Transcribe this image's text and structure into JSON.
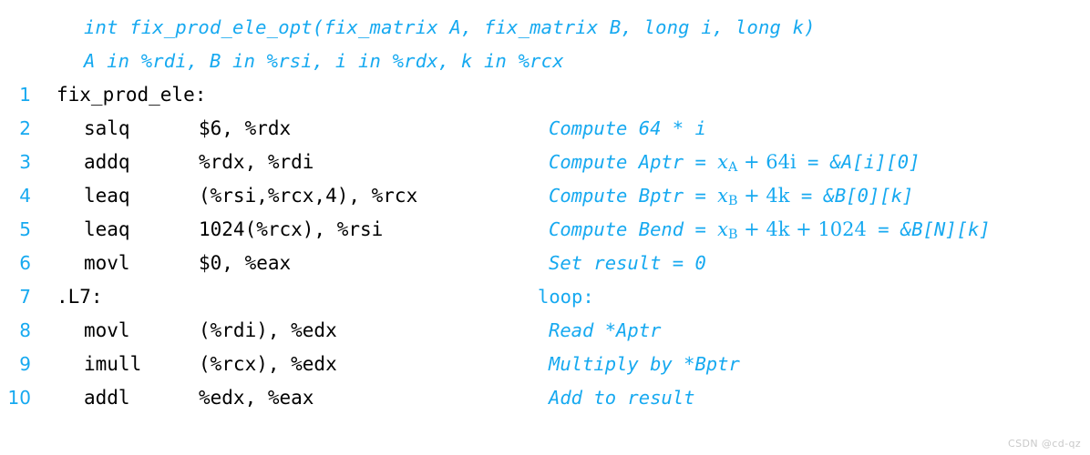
{
  "colors": {
    "accent_blue": "#16a9f0",
    "code_black": "#000000",
    "background": "#ffffff",
    "watermark_gray": "#c9c9c9"
  },
  "header": {
    "signature": "int fix_prod_ele_opt(fix_matrix A, fix_matrix B, long i, long k)",
    "registers": "A in %rdi, B in %rsi, i in %rdx, k in %rcx"
  },
  "code": [
    {
      "lineno": "1",
      "label": "fix_prod_ele:",
      "mnemonic": "",
      "operands": "",
      "comment": ""
    },
    {
      "lineno": "2",
      "label": "",
      "mnemonic": "salq",
      "operands": "$6, %rdx",
      "comment": "Compute 64 * i"
    },
    {
      "lineno": "3",
      "label": "",
      "mnemonic": "addq",
      "operands": "%rdx, %rdi",
      "comment": "Compute Aptr = xA + 64i = &A[i][0]",
      "comment_parts": {
        "pre": "Compute Aptr = ",
        "math": "xA + 64i",
        "post": " = &A[i][0]"
      }
    },
    {
      "lineno": "4",
      "label": "",
      "mnemonic": "leaq",
      "operands": "(%rsi,%rcx,4), %rcx",
      "comment": "Compute Bptr = xB + 4k = &B[0][k]",
      "comment_parts": {
        "pre": "Compute Bptr = ",
        "math": "xB + 4k",
        "post": " = &B[0][k]"
      }
    },
    {
      "lineno": "5",
      "label": "",
      "mnemonic": "leaq",
      "operands": "1024(%rcx), %rsi",
      "comment": "Compute Bend = xB + 4k + 1024 = &B[N][k]",
      "comment_parts": {
        "pre": "Compute Bend = ",
        "math": "xB + 4k + 1024",
        "post": " = &B[N][k]"
      }
    },
    {
      "lineno": "6",
      "label": "",
      "mnemonic": "movl",
      "operands": "$0, %eax",
      "comment": "Set result = 0"
    },
    {
      "lineno": "7",
      "label": ".L7:",
      "mnemonic": "",
      "operands": "",
      "comment": "loop:",
      "comment_style": "upright"
    },
    {
      "lineno": "8",
      "label": "",
      "mnemonic": "movl",
      "operands": "(%rdi), %edx",
      "comment": "Read *Aptr"
    },
    {
      "lineno": "9",
      "label": "",
      "mnemonic": "imull",
      "operands": "(%rcx), %edx",
      "comment": "Multiply by *Bptr"
    },
    {
      "lineno": "10",
      "label": "",
      "mnemonic": "addl",
      "operands": "%edx, %eax",
      "comment": "Add to result"
    }
  ],
  "math_fragments": {
    "row3": {
      "base": "x",
      "sub": "A",
      "rest": " + 64i"
    },
    "row4": {
      "base": "x",
      "sub": "B",
      "rest": " + 4k"
    },
    "row5": {
      "base": "x",
      "sub": "B",
      "rest": " + 4k + 1024"
    }
  },
  "watermark": "CSDN @cd-qz"
}
